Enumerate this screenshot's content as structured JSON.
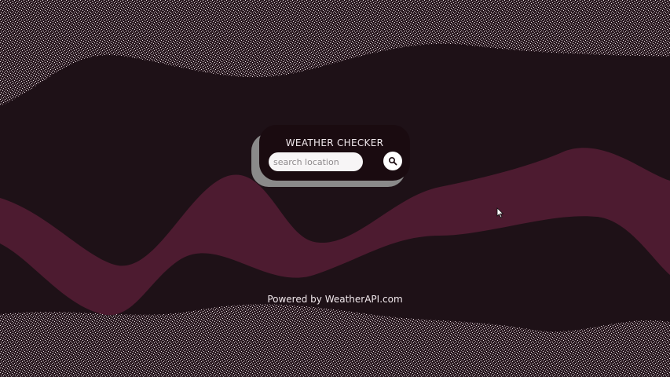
{
  "app": {
    "title": "WEATHER CHECKER",
    "footer": "Powered by WeatherAPI.com"
  },
  "search": {
    "placeholder": "search location",
    "value": "",
    "button_icon": "search-icon"
  },
  "colors": {
    "background": "#1e1117",
    "wave": "#4d1b30",
    "card": "#1a0b10",
    "speckle": "#e8e0e3"
  }
}
